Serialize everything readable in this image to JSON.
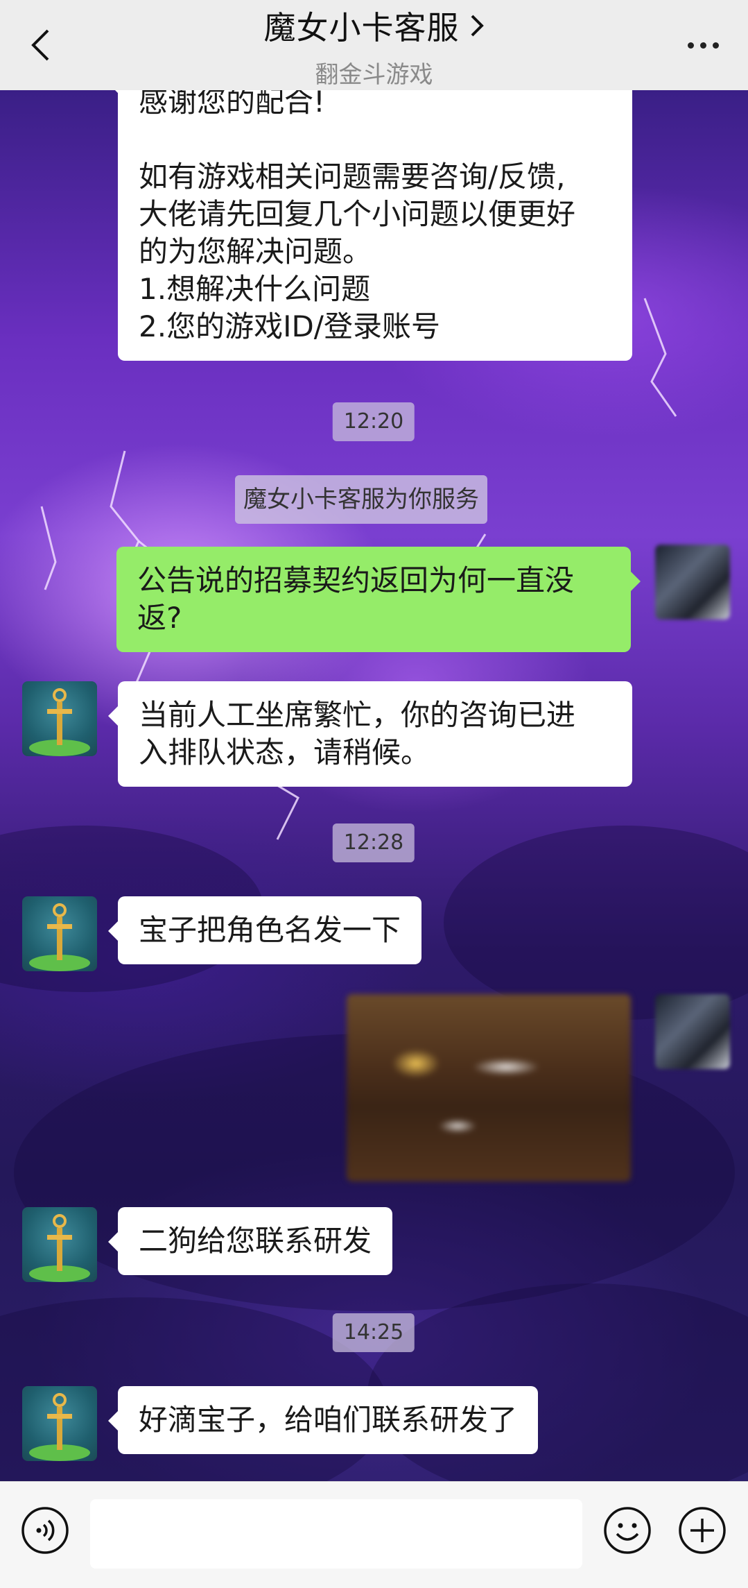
{
  "header": {
    "title": "魔女小卡客服",
    "subtitle": "翻金斗游戏"
  },
  "messages": [
    {
      "from": "agent",
      "lines": [
        "感谢您的配合!",
        "",
        "如有游戏相关问题需要咨询/反馈,",
        "大佬请先回复几个小问题以便更好",
        "的为您解决问题。",
        "1.想解决什么问题",
        "2.您的游戏ID/登录账号"
      ]
    },
    {
      "type": "time",
      "text": "12:20"
    },
    {
      "type": "system",
      "text": "魔女小卡客服为你服务"
    },
    {
      "from": "user",
      "lines": [
        "公告说的招募契约返回为何一直没",
        "返?"
      ]
    },
    {
      "from": "agent",
      "lines": [
        "当前人工坐席繁忙，你的咨询已进",
        "入排队状态，请稍候。"
      ]
    },
    {
      "type": "time",
      "text": "12:28"
    },
    {
      "from": "agent",
      "lines": [
        "宝子把角色名发一下"
      ]
    },
    {
      "from": "user",
      "type": "image"
    },
    {
      "from": "agent",
      "lines": [
        "二狗给您联系研发"
      ]
    },
    {
      "type": "time",
      "text": "14:25"
    },
    {
      "from": "agent",
      "lines": [
        "好滴宝子，给咱们联系研发了"
      ]
    }
  ],
  "input": {
    "value": "",
    "placeholder": ""
  },
  "icons": {
    "back": "chevron-left-icon",
    "title_arrow": "chevron-right-icon",
    "more": "more-icon",
    "voice": "voice-icon",
    "emoji": "emoji-icon",
    "plus": "plus-icon"
  },
  "colors": {
    "header_bg": "#ededed",
    "self_bubble": "#95ec69",
    "other_bubble": "#ffffff",
    "input_bar": "#f6f6f6"
  }
}
